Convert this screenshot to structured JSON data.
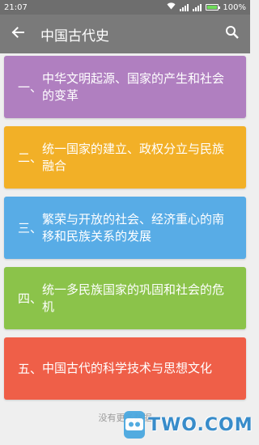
{
  "status_bar": {
    "time": "21:07",
    "battery": "100%"
  },
  "toolbar": {
    "title": "中国古代史",
    "back_icon": "arrow-left-icon",
    "search_icon": "search-icon"
  },
  "items": [
    {
      "num": "一、",
      "text": "中华文明起源、国家的产生和社会的变革",
      "color": "#b07fc0"
    },
    {
      "num": "二、",
      "text": "统一国家的建立、政权分立与民族融合",
      "color": "#f2b027"
    },
    {
      "num": "三、",
      "text": "繁荣与开放的社会、经济重心的南移和民族关系的发展",
      "color": "#58ace6"
    },
    {
      "num": "四、",
      "text": "统一多民族国家的巩固和社会的危机",
      "color": "#8bc34a"
    },
    {
      "num": "五、",
      "text": "中国古代的科学技术与思想文化",
      "color": "#ef5f48"
    }
  ],
  "footer": "没有更多数据",
  "watermark": "TWO.COM"
}
